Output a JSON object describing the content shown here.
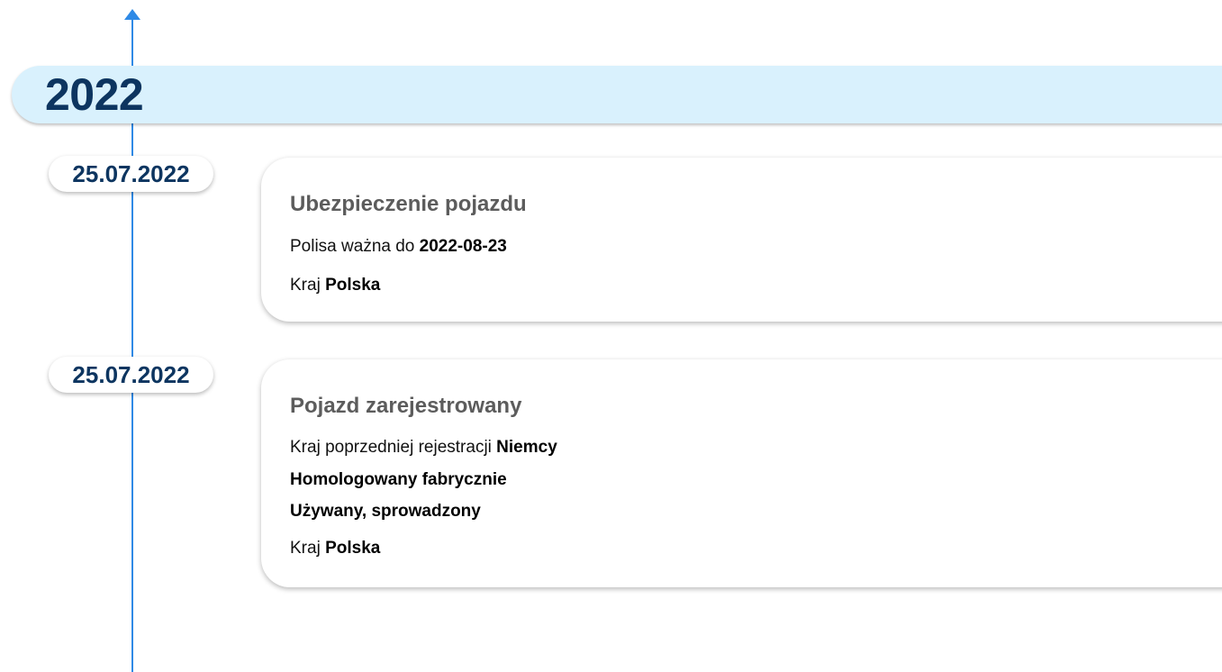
{
  "timeline": {
    "year": "2022",
    "events": [
      {
        "date": "25.07.2022",
        "title": "Ubezpieczenie pojazdu",
        "policy_prefix": "Polisa ważna do",
        "policy_value": "2022-08-23",
        "country_prefix": "Kraj",
        "country_value": "Polska"
      },
      {
        "date": "25.07.2022",
        "title": "Pojazd zarejestrowany",
        "prev_country_prefix": "Kraj poprzedniej rejestracji",
        "prev_country_value": "Niemcy",
        "homologation": "Homologowany fabrycznie",
        "usage": "Używany, sprowadzony",
        "country_prefix": "Kraj",
        "country_value": "Polska"
      }
    ]
  },
  "colors": {
    "line": "#2f8ae6",
    "year_banner_bg": "#d9f1fd",
    "date_text": "#0d3560",
    "card_title": "#5c5c5c"
  },
  "icons": {
    "timeline_top": "arrow-up-icon"
  }
}
